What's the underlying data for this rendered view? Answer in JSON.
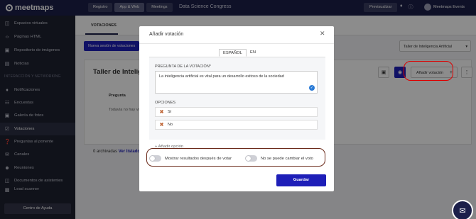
{
  "app": {
    "logo_text": "meetmaps"
  },
  "topbar": {
    "tabs": [
      {
        "label": "Registro"
      },
      {
        "label": "App & Web"
      },
      {
        "label": "Meetings"
      }
    ],
    "event_name": "Data Science Congress",
    "preview_label": "Previsualizar",
    "user_name": "Meetmaps Events"
  },
  "sidebar": {
    "items_top": [
      {
        "label": "Espacios virtuales",
        "icon": "cube-icon"
      },
      {
        "label": "Páginas HTML",
        "icon": "code-icon"
      },
      {
        "label": "Repositorio de imágenes",
        "icon": "image-icon"
      },
      {
        "label": "Noticias",
        "icon": "news-icon"
      }
    ],
    "section_label": "INTERACCIÓN Y NETWORKING",
    "items_bottom": [
      {
        "label": "Notificaciones",
        "icon": "bell-icon"
      },
      {
        "label": "Encuestas",
        "icon": "survey-icon"
      },
      {
        "label": "Galería de fotos",
        "icon": "photo-icon"
      },
      {
        "label": "Votaciones",
        "icon": "vote-icon"
      },
      {
        "label": "Preguntas al ponente",
        "icon": "question-icon"
      },
      {
        "label": "Canales",
        "icon": "channel-icon"
      },
      {
        "label": "Reuniones",
        "icon": "meeting-icon"
      },
      {
        "label": "Documentos de asistentes",
        "icon": "document-icon"
      },
      {
        "label": "Lead scanner",
        "icon": "scanner-icon"
      }
    ],
    "help_label": "Centro de Ayuda"
  },
  "main": {
    "tab_label": "VOTACIONES",
    "new_session_label": "Nueva sesión de votaciones",
    "session_select_value": "Taller de Inteligencia Artificial",
    "card_title": "Taller de Inteligencia Artificial",
    "add_vote_label": "Añadir votación",
    "column_header": "Pregunta",
    "empty_message": "Todavía no hay votaciones",
    "archived_count": "0 archivadas",
    "archived_link": "Ver listado"
  },
  "modal": {
    "title": "Añadir votación",
    "lang_tabs": [
      {
        "label": "ESPAÑOL"
      },
      {
        "label": "EN"
      }
    ],
    "question_label": "PREGUNTA DE LA VOTACIÓN*",
    "question_value": "La inteligencia artificial es vital para un desarrollo exitoso de la sociedad",
    "options_label": "OPCIONES",
    "options": [
      {
        "label": "Sí"
      },
      {
        "label": "No"
      }
    ],
    "add_option_label": "+ Añadir opción",
    "toggle_show_results": "Mostrar resultados después de votar",
    "toggle_no_change": "No se puede cambiar el voto",
    "save_label": "Guardar"
  },
  "colors": {
    "topbar": "#1c1f4a",
    "primary_button": "#1e1fb8",
    "annotation_oval": "#dd0000"
  }
}
